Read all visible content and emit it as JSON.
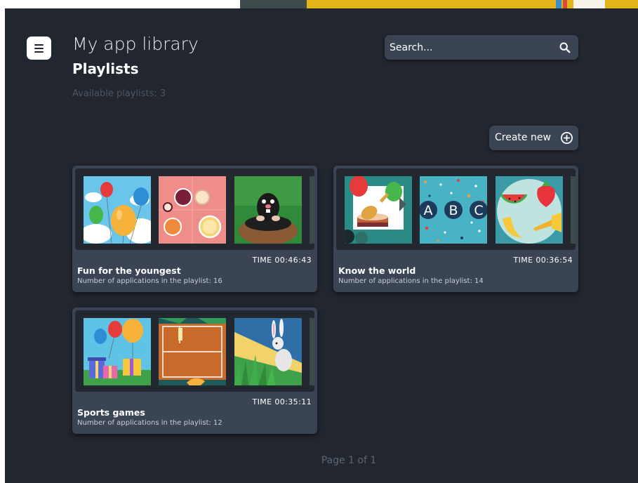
{
  "app": {
    "title": "My app library"
  },
  "page": {
    "title": "Playlists",
    "available": "Available playlists: 3"
  },
  "search": {
    "placeholder": "Search...",
    "value": "",
    "icon": "search-icon"
  },
  "actions": {
    "create_new_label": "Create new",
    "create_icon": "plus-circle-icon"
  },
  "menu": {
    "icon": "menu-icon"
  },
  "playlists": [
    {
      "name": "Fun for the youngest",
      "time": "TIME 00:46:43",
      "count": "Number of applications in the playlist: 16",
      "thumbnails": [
        "balloons",
        "circle-puzzle",
        "mole"
      ]
    },
    {
      "name": "Know the world",
      "time": "TIME 00:36:54",
      "count": "Number of applications in the playlist: 14",
      "thumbnails": [
        "guitar-cake",
        "abc-letters",
        "fruits-trumpet"
      ]
    },
    {
      "name": "Sports games",
      "time": "TIME 00:35:11",
      "count": "Number of applications in the playlist: 12",
      "thumbnails": [
        "gifts-balloons",
        "tennis-court",
        "rabbit-grass"
      ]
    }
  ],
  "pagination": {
    "label": "Page 1 of 1"
  },
  "colors": {
    "background": "#22262e",
    "card": "#3a4453",
    "button": "#3a4453",
    "text": "#ffffff",
    "muted": "#4e5663"
  }
}
